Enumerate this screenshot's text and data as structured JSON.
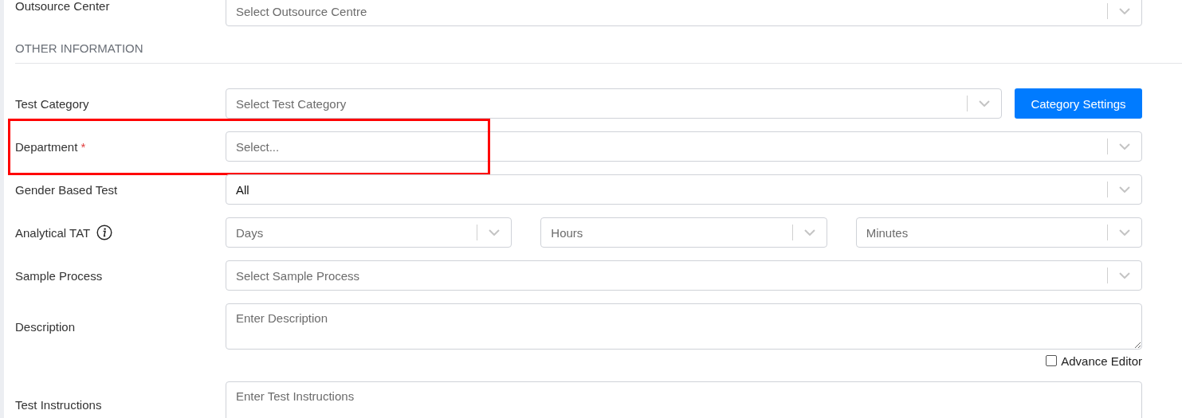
{
  "top_fields": [
    {
      "kind": "select",
      "label": "Outsource Center",
      "placeholder": "Select Outsource Centre"
    }
  ],
  "section": {
    "title": "OTHER INFORMATION"
  },
  "fields": [
    {
      "kind": "select",
      "label": "Test Category",
      "placeholder": "Select Test Category",
      "button": "Category Settings"
    },
    {
      "kind": "select",
      "label": "Department",
      "required_mark": "*",
      "highlighted": true,
      "placeholder": "Select..."
    },
    {
      "kind": "select",
      "label": "Gender Based Test",
      "value": "All"
    },
    {
      "kind": "multi",
      "label": "Analytical TAT",
      "info": true,
      "selects": [
        {
          "placeholder": "Days"
        },
        {
          "placeholder": "Hours"
        },
        {
          "placeholder": "Minutes"
        }
      ]
    },
    {
      "kind": "select",
      "label": "Sample Process",
      "placeholder": "Select Sample Process"
    },
    {
      "kind": "textarea",
      "label": "Description",
      "placeholder": "Enter Description",
      "option": {
        "label": "Advance Editor",
        "checked": false
      }
    },
    {
      "kind": "textarea",
      "label": "Test Instructions",
      "placeholder": "Enter Test Instructions"
    }
  ]
}
